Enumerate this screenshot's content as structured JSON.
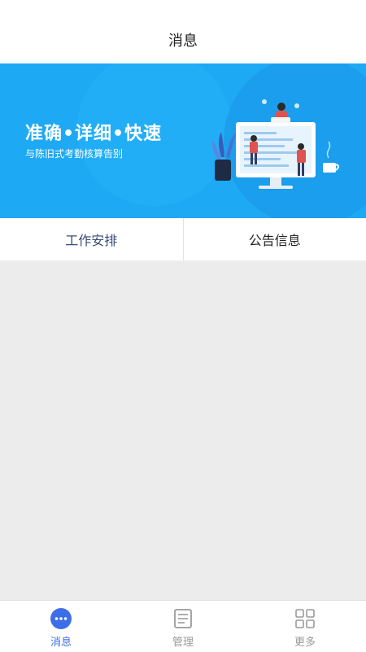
{
  "header": {
    "title": "消息"
  },
  "banner": {
    "headline": "准确•详细•快速",
    "subtitle": "与陈旧式考勤核算告别"
  },
  "tabs": [
    {
      "label": "工作安排",
      "active": true
    },
    {
      "label": "公告信息",
      "active": false
    }
  ],
  "bottom_nav": [
    {
      "label": "消息",
      "icon": "chat-bubble-icon",
      "active": true
    },
    {
      "label": "管理",
      "icon": "document-icon",
      "active": false
    },
    {
      "label": "更多",
      "icon": "grid-icon",
      "active": false
    }
  ],
  "colors": {
    "banner": "#1ea9f5",
    "accent": "#3d6ee8",
    "active_tab_text": "#3a4a78",
    "content_bg": "#ececec"
  }
}
